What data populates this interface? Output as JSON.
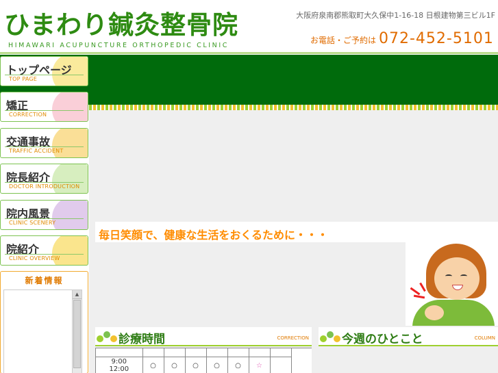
{
  "header": {
    "title": "ひまわり鍼灸整骨院",
    "subtitle": "HIMAWARI  ACUPUNCTURE ORTHOPEDIC CLINIC",
    "address": "大阪府泉南郡熊取町大久保中1-16-18 日根建物第三ビル1F",
    "tel_label": "お電話・ご予約は",
    "tel_number": "072-452-5101"
  },
  "nav": [
    {
      "jp": "トップページ",
      "en": "TOP PAGE",
      "color": "#f5d84a"
    },
    {
      "jp": "矯正",
      "en": "CORRECTION",
      "color": "#f6a7b8"
    },
    {
      "jp": "交通事故",
      "en": "TRAFFIC ACCIDENT",
      "color": "#f5c542"
    },
    {
      "jp": "院長紹介",
      "en": "DOCTOR INTRODUCTION",
      "color": "#b7e08a"
    },
    {
      "jp": "院内風景",
      "en": "CLINIC SCENERY",
      "color": "#c9a0dc"
    },
    {
      "jp": "院紹介",
      "en": "CLINIC OVERVIEW",
      "color": "#f5d030"
    }
  ],
  "news": {
    "title": "新着情報",
    "scroll_up": "▲"
  },
  "catchphrase": "毎日笑顔で、健康な生活をおくるために・・・",
  "sections": {
    "hours": {
      "title": "診療時間",
      "en": "CORRECTION"
    },
    "weekly": {
      "title": "今週のひとこと",
      "en": "COLUMN"
    }
  },
  "schedule": {
    "rows": [
      {
        "time": "9:00\n12:00",
        "cells": [
          "○",
          "○",
          "○",
          "○",
          "○",
          "☆",
          ""
        ]
      }
    ]
  },
  "colors": {
    "brand_green": "#2e8b12",
    "banner_green": "#006b0c",
    "accent_orange": "#e06b00"
  }
}
